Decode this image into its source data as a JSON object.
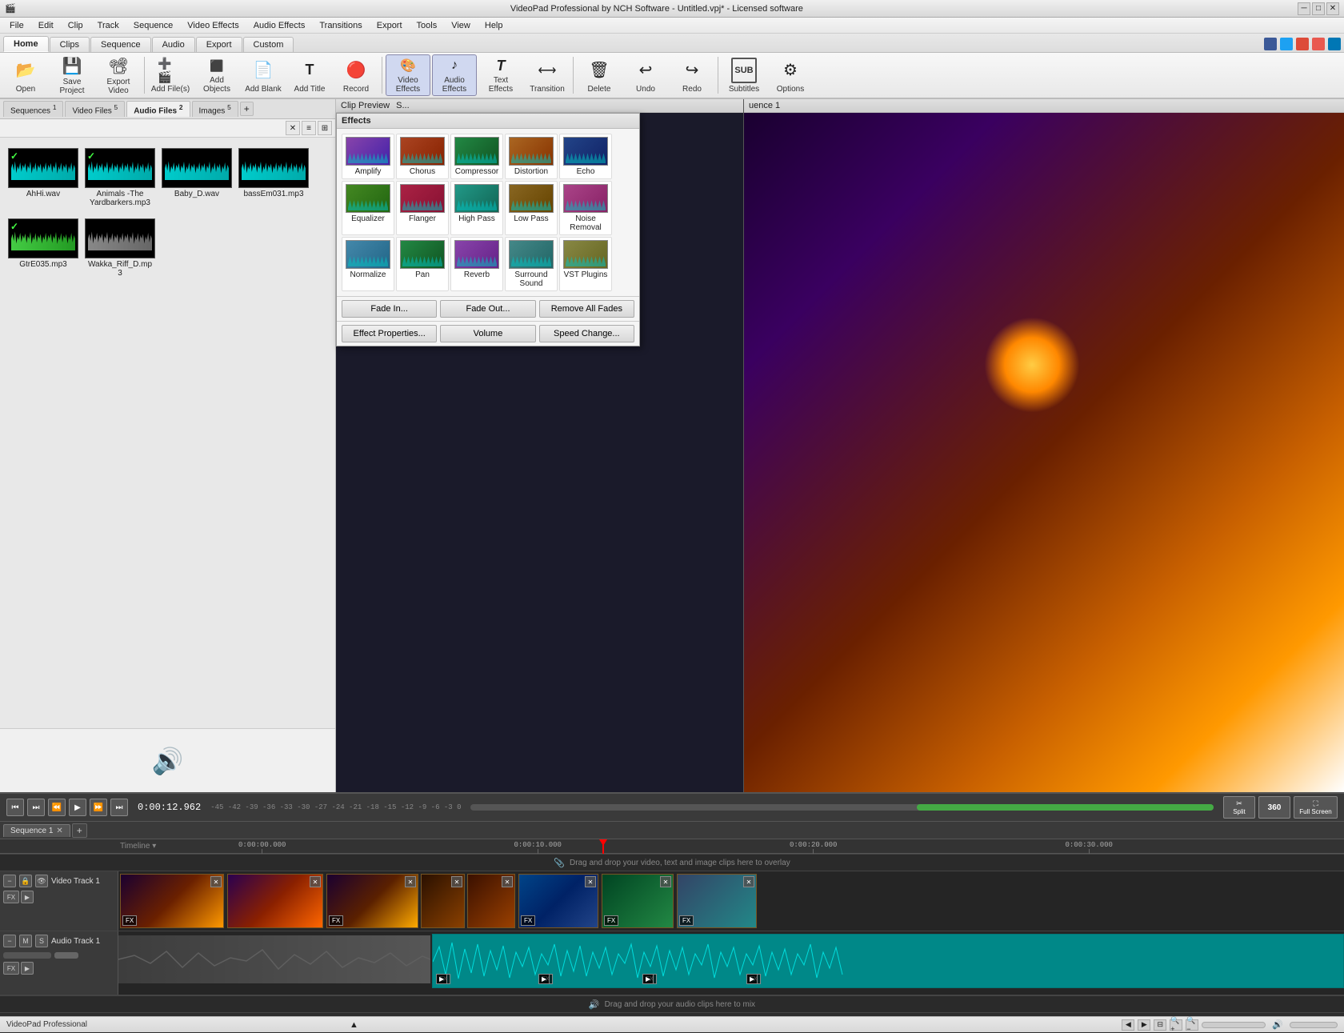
{
  "titlebar": {
    "title": "VideoPad Professional by NCH Software - Untitled.vpj* - Licensed software"
  },
  "menubar": {
    "items": [
      "File",
      "Edit",
      "Clip",
      "Track",
      "Sequence",
      "Video Effects",
      "Audio Effects",
      "Transitions",
      "Export",
      "Tools",
      "View",
      "Help"
    ]
  },
  "toolbar_tabs": {
    "tabs": [
      "Home",
      "Clips",
      "Sequence",
      "Audio",
      "Export",
      "Custom"
    ]
  },
  "toolbar": {
    "buttons": [
      {
        "id": "open",
        "label": "Open",
        "icon": "📂"
      },
      {
        "id": "save-project",
        "label": "Save Project",
        "icon": "💾"
      },
      {
        "id": "export-video",
        "label": "Export Video",
        "icon": "🎬"
      },
      {
        "id": "add-files",
        "label": "Add File(s)",
        "icon": "➕"
      },
      {
        "id": "add-objects",
        "label": "Add Objects",
        "icon": "⬛"
      },
      {
        "id": "add-blank",
        "label": "Add Blank",
        "icon": "📄"
      },
      {
        "id": "add-title",
        "label": "Add Title",
        "icon": "T"
      },
      {
        "id": "record",
        "label": "Record",
        "icon": "🔴"
      },
      {
        "id": "video-effects",
        "label": "Video Effects",
        "icon": "🎨"
      },
      {
        "id": "audio-effects",
        "label": "Audio Effects",
        "icon": "♪"
      },
      {
        "id": "text-effects",
        "label": "Text Effects",
        "icon": "A"
      },
      {
        "id": "transition",
        "label": "Transition",
        "icon": "⟷"
      },
      {
        "id": "delete",
        "label": "Delete",
        "icon": "🗑"
      },
      {
        "id": "undo",
        "label": "Undo",
        "icon": "↩"
      },
      {
        "id": "redo",
        "label": "Redo",
        "icon": "↪"
      },
      {
        "id": "subtitles",
        "label": "Subtitles",
        "icon": "SUB"
      },
      {
        "id": "options",
        "label": "Options",
        "icon": "⚙"
      }
    ]
  },
  "file_tabs": {
    "tabs": [
      {
        "label": "Sequences 1",
        "active": false
      },
      {
        "label": "Video Files 5",
        "active": false
      },
      {
        "label": "Audio Files 2",
        "active": true
      },
      {
        "label": "Images 5",
        "active": false
      },
      {
        "label": "+",
        "active": false
      }
    ]
  },
  "audio_files": [
    {
      "name": "AhHi.wav",
      "has_check": true,
      "color": "cyan"
    },
    {
      "name": "Animals -The Yardbarkers.mp3",
      "has_check": true,
      "color": "cyan"
    },
    {
      "name": "Baby_D.wav",
      "has_check": false,
      "color": "cyan"
    },
    {
      "name": "bassEm031.mp3",
      "has_check": false,
      "color": "cyan"
    },
    {
      "name": "GtrE035.mp3",
      "has_check": true,
      "color": "green"
    },
    {
      "name": "Wakka_Riff_D.mp3",
      "has_check": false,
      "color": "gray"
    }
  ],
  "preview": {
    "clip_preview_label": "Clip Preview",
    "sequence_label": "uence 1"
  },
  "effects": {
    "title": "Effects",
    "items": [
      {
        "id": "amplify",
        "name": "Amplify",
        "class": "et-amplify"
      },
      {
        "id": "chorus",
        "name": "Chorus",
        "class": "et-chorus"
      },
      {
        "id": "compressor",
        "name": "Compressor",
        "class": "et-compressor"
      },
      {
        "id": "distortion",
        "name": "Distortion",
        "class": "et-distortion"
      },
      {
        "id": "echo",
        "name": "Echo",
        "class": "et-echo"
      },
      {
        "id": "equalizer",
        "name": "Equalizer",
        "class": "et-equalizer"
      },
      {
        "id": "flanger",
        "name": "Flanger",
        "class": "et-flanger"
      },
      {
        "id": "highpass",
        "name": "High Pass",
        "class": "et-highpass"
      },
      {
        "id": "lowpass",
        "name": "Low Pass",
        "class": "et-lowpass"
      },
      {
        "id": "noiseremoval",
        "name": "Noise Removal",
        "class": "et-noiseremoval"
      },
      {
        "id": "normalize",
        "name": "Normalize",
        "class": "et-normalize"
      },
      {
        "id": "pan",
        "name": "Pan",
        "class": "et-pan"
      },
      {
        "id": "reverb",
        "name": "Reverb",
        "class": "et-reverb"
      },
      {
        "id": "surround",
        "name": "Surround Sound",
        "class": "et-surround"
      },
      {
        "id": "vst",
        "name": "VST Plugins",
        "class": "et-vst"
      }
    ],
    "buttons": {
      "fade_in": "Fade In...",
      "fade_out": "Fade Out...",
      "remove_fades": "Remove All Fades",
      "effect_properties": "Effect Properties...",
      "volume": "Volume",
      "speed_change": "Speed Change..."
    }
  },
  "playback": {
    "time": "0:00:12.962",
    "buttons": [
      "⏮",
      "⏭",
      "⏪",
      "▶",
      "⏩",
      "⏭"
    ]
  },
  "timeline": {
    "sequence_tab": "Sequence 1",
    "ruler_marks": [
      "0:00:00.000",
      "0:00:10.000",
      "0:00:20.000",
      "0:00:30.000"
    ],
    "video_track_label": "Video Track 1",
    "audio_track_label": "Audio Track 1",
    "drop_hint_video": "Drag and drop your video, text and image clips here to overlay",
    "drop_hint_audio": "Drag and drop your audio clips here to mix"
  },
  "statusbar": {
    "text": "VideoPad Professional",
    "vol_labels": "-45  -42  -39  -36  -33  -30  -27  -24  -21  -18  -15  -12  -9  -6  -3  0"
  }
}
